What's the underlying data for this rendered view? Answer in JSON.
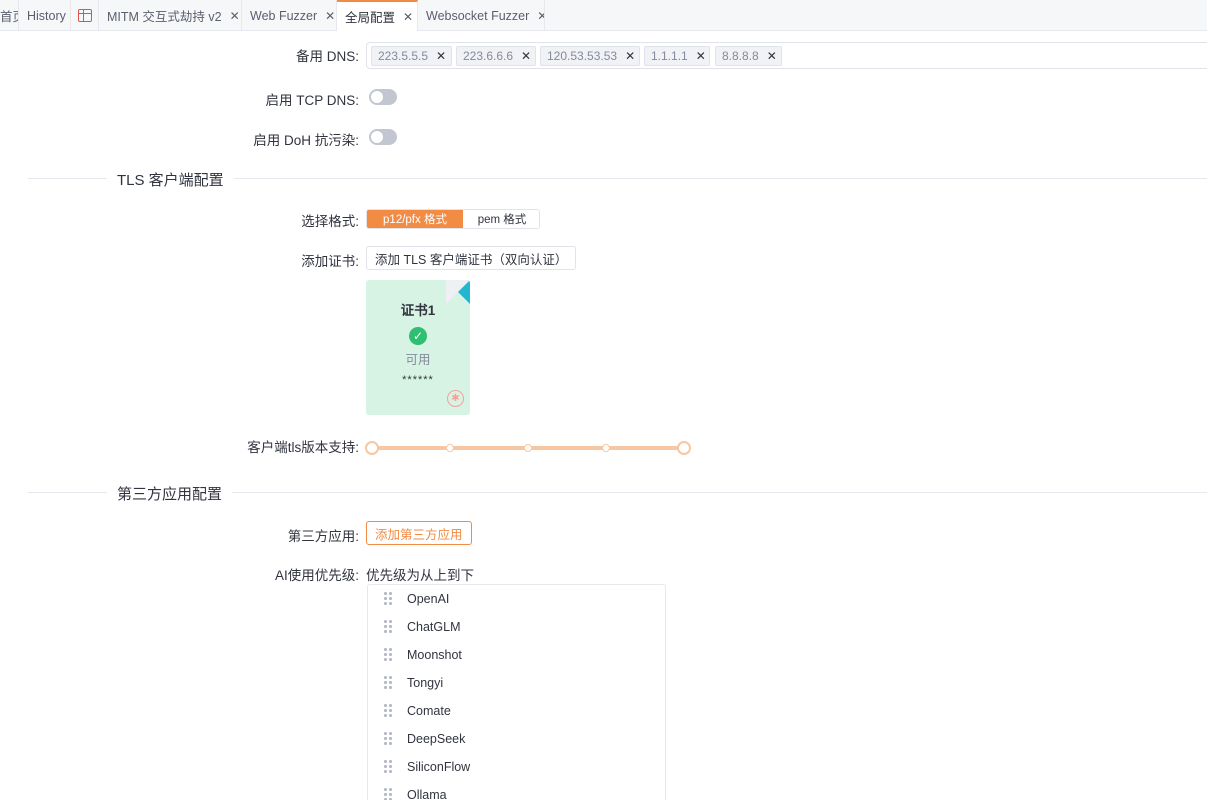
{
  "tabs": [
    {
      "label": "首页",
      "active": false
    },
    {
      "label": "History",
      "active": false
    },
    {
      "icon": "spreadsheet-icon",
      "active": false
    },
    {
      "label": "MITM 交互式劫持 v2",
      "active": false
    },
    {
      "label": "Web Fuzzer",
      "active": false
    },
    {
      "label": "全局配置",
      "active": true
    },
    {
      "label": "Websocket Fuzzer",
      "active": false
    }
  ],
  "dns": {
    "backup_label": "备用 DNS:",
    "servers": [
      "223.5.5.5",
      "223.6.6.6",
      "120.53.53.53",
      "1.1.1.1",
      "8.8.8.8"
    ],
    "tcp_label": "启用 TCP DNS:",
    "tcp_enabled": false,
    "doh_label": "启用 DoH 抗污染:",
    "doh_enabled": false
  },
  "tls": {
    "section_title": "TLS 客户端配置",
    "format_label": "选择格式:",
    "format_options": [
      "p12/pfx 格式",
      "pem 格式"
    ],
    "format_selected": "p12/pfx 格式",
    "add_cert_label": "添加证书:",
    "add_cert_button": "添加 TLS 客户端证书（双向认证）",
    "cert": {
      "title": "证书1",
      "status": "可用",
      "password": "******"
    },
    "version_label": "客户端tls版本支持:",
    "version_range": [
      0,
      1
    ],
    "version_steps": 5
  },
  "third_party": {
    "section_title": "第三方应用配置",
    "app_label": "第三方应用:",
    "add_button": "添加第三方应用",
    "ai_priority_label": "AI使用优先级:",
    "ai_priority_hint": "优先级为从上到下",
    "ai_providers": [
      "OpenAI",
      "ChatGLM",
      "Moonshot",
      "Tongyi",
      "Comate",
      "DeepSeek",
      "SiliconFlow",
      "Ollama"
    ]
  },
  "colors": {
    "accent": "#f28b44",
    "card_bg": "#d7f3e4",
    "success": "#2fbf71",
    "corner": "#22b6d1",
    "danger_light": "#f0a39c"
  }
}
